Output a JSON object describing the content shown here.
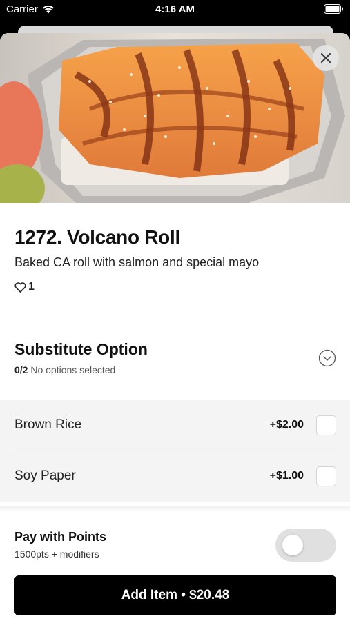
{
  "status_bar": {
    "carrier": "Carrier",
    "time": "4:16 AM"
  },
  "item": {
    "title": "1272. Volcano Roll",
    "description": "Baked CA roll with salmon and special mayo",
    "likes": "1"
  },
  "substitute": {
    "title": "Substitute Option",
    "selected_count": "0/2",
    "selected_text": "No options selected",
    "options": [
      {
        "label": "Brown Rice",
        "price": "+$2.00",
        "checked": false
      },
      {
        "label": "Soy Paper",
        "price": "+$1.00",
        "checked": false
      }
    ]
  },
  "points": {
    "title": "Pay with Points",
    "subtitle": "1500pts + modifiers",
    "enabled": false
  },
  "add_button_label": "Add Item • $20.48",
  "icons": {
    "close": "close-icon",
    "heart": "heart-icon",
    "chevron": "chevron-down-icon",
    "wifi": "wifi-icon",
    "battery": "battery-icon"
  },
  "colors": {
    "primary_button": "#000000",
    "options_background": "#f4f4f4",
    "toggle_off": "#e0e0e0"
  }
}
